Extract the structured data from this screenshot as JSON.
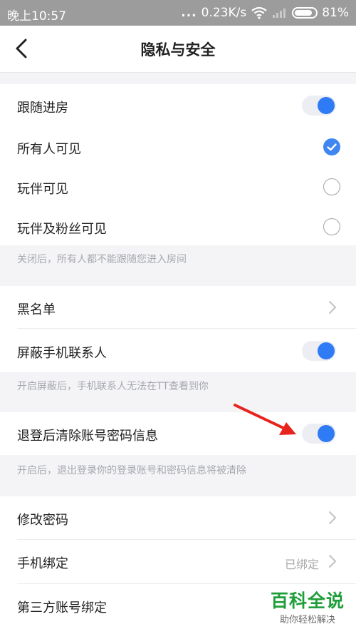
{
  "statusbar": {
    "time": "晚上10:57",
    "dots": "...",
    "speed": "0.23K/s",
    "battery": "81%"
  },
  "header": {
    "title": "隐私与安全"
  },
  "follow": {
    "label": "跟随进房",
    "options": [
      {
        "label": "所有人可见",
        "selected": true
      },
      {
        "label": "玩伴可见",
        "selected": false
      },
      {
        "label": "玩伴及粉丝可见",
        "selected": false
      }
    ],
    "note": "关闭后，所有人都不能跟随您进入房间"
  },
  "blacklist": {
    "label": "黑名单"
  },
  "block_contacts": {
    "label": "屏蔽手机联系人",
    "note": "开启屏蔽后，手机联系人无法在TT查看到你"
  },
  "clear_on_logout": {
    "label": "退登后清除账号密码信息",
    "note": "开启后，退出登录你的登录账号和密码信息将被清除"
  },
  "change_password": {
    "label": "修改密码"
  },
  "phone_binding": {
    "label": "手机绑定",
    "status": "已绑定"
  },
  "third_party": {
    "label": "第三方账号绑定"
  },
  "watermark": {
    "main": "百科全说",
    "sub": "助你轻松解决"
  },
  "colors": {
    "accent": "#2f7af5",
    "arrow": "#e8231e"
  }
}
